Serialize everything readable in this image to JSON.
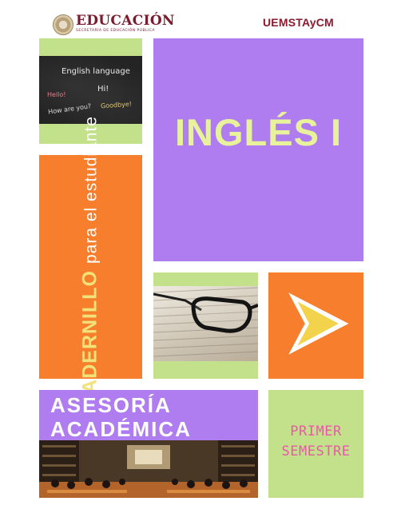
{
  "header": {
    "ministry": "EDUCACIÓN",
    "ministry_sub": "SECRETARÍA DE EDUCACIÓN PÚBLICA",
    "institution": "UEMSTAyCM"
  },
  "chalkboard": {
    "line1": "English language",
    "hello": "Hello!",
    "hi": "Hi!",
    "how": "How are you?",
    "goodbye": "Goodbye!"
  },
  "cover": {
    "title": "INGLÉS I",
    "vertical_bold": "CUADERNILLO",
    "vertical_light": "para el estudiante",
    "asesoria_line1": "ASESORÍA",
    "asesoria_line2": "ACADÉMICA",
    "semester_line1": "PRIMER",
    "semester_line2": "SEMESTRE"
  },
  "colors": {
    "green": "#c3e18a",
    "purple": "#b07df0",
    "orange": "#f67e2c",
    "title_yellow": "#e7f29a",
    "pink": "#e85aa8",
    "maroon": "#8b1a2e"
  }
}
